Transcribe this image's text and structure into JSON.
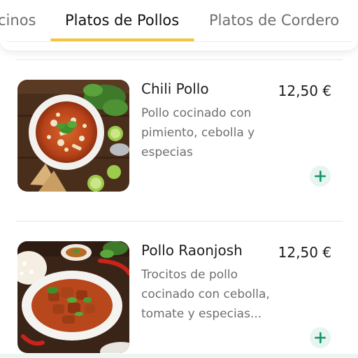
{
  "tabs": [
    {
      "label": "cinos"
    },
    {
      "label": "Platos de Pollos"
    },
    {
      "label": "Platos de Cordero"
    }
  ],
  "active_tab_index": 1,
  "accent_color": "#f4c542",
  "add_button_color": "#17936a",
  "items": [
    {
      "name": "Chili Pollo",
      "price": "12,50 €",
      "description": "Pollo cocinado con pimiento, cebolla y especias",
      "image_icon": "chili-pollo-photo",
      "add_icon": "plus-icon"
    },
    {
      "name": "Pollo Raonjosh",
      "price": "12,50 €",
      "description": "Trocitos de pollo cocinado con cebolla, tomate y especias...",
      "image_icon": "pollo-raonjosh-photo",
      "add_icon": "plus-icon"
    }
  ]
}
